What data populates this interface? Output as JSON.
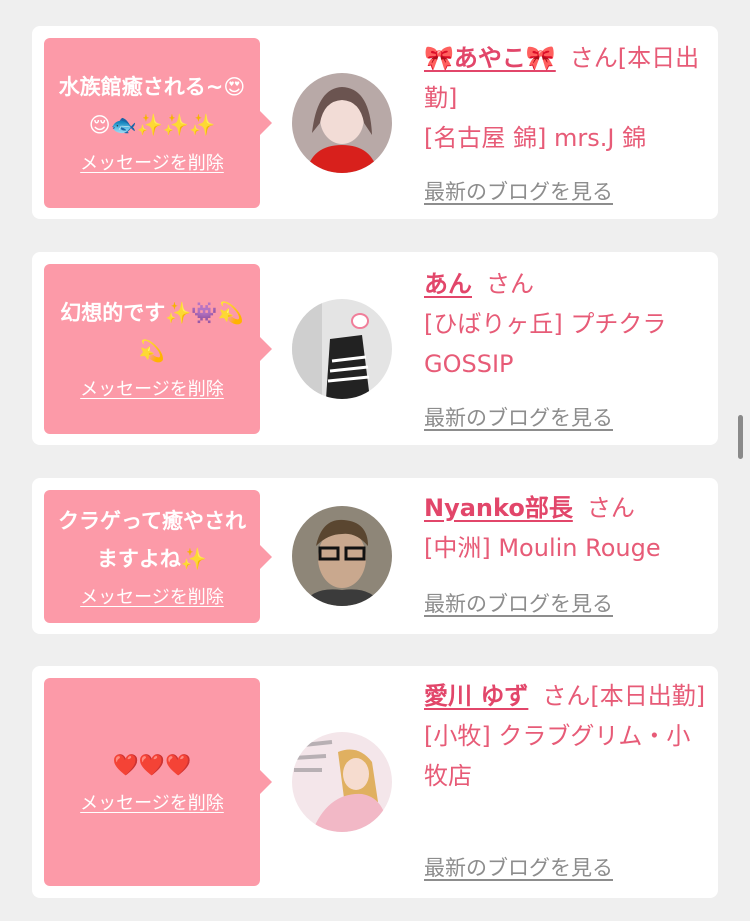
{
  "cards": [
    {
      "message": "水族館癒される~😍😌🐟✨✨✨",
      "delete_label": "メッセージを削除",
      "name": "🎀あやこ🎀",
      "honorific": "さん",
      "status": "[本日出勤]",
      "shop": "[名古屋 錦] mrs.J 錦",
      "blog_link": "最新のブログを見る"
    },
    {
      "message": "幻想的です✨👾💫💫",
      "delete_label": "メッセージを削除",
      "name": "あん",
      "honorific": "さん",
      "status": "",
      "shop": "[ひばりヶ丘] プチクラGOSSIP",
      "blog_link": "最新のブログを見る"
    },
    {
      "message": "クラゲって癒やされますよね✨",
      "delete_label": "メッセージを削除",
      "name": "Nyanko部長",
      "honorific": "さん",
      "status": "",
      "shop": "[中洲] Moulin Rouge",
      "blog_link": "最新のブログを見る"
    },
    {
      "message": "❤️❤️❤️",
      "delete_label": "メッセージを削除",
      "name": "愛川 ゆず",
      "honorific": "さん",
      "status": "[本日出勤]",
      "shop": "[小牧] クラブグリム・小牧店",
      "blog_link": "最新のブログを見る"
    }
  ],
  "colors": {
    "bubble": "#fc9aa8",
    "name": "#e2466a",
    "text": "#e75b77",
    "link": "#8d8d8d"
  }
}
